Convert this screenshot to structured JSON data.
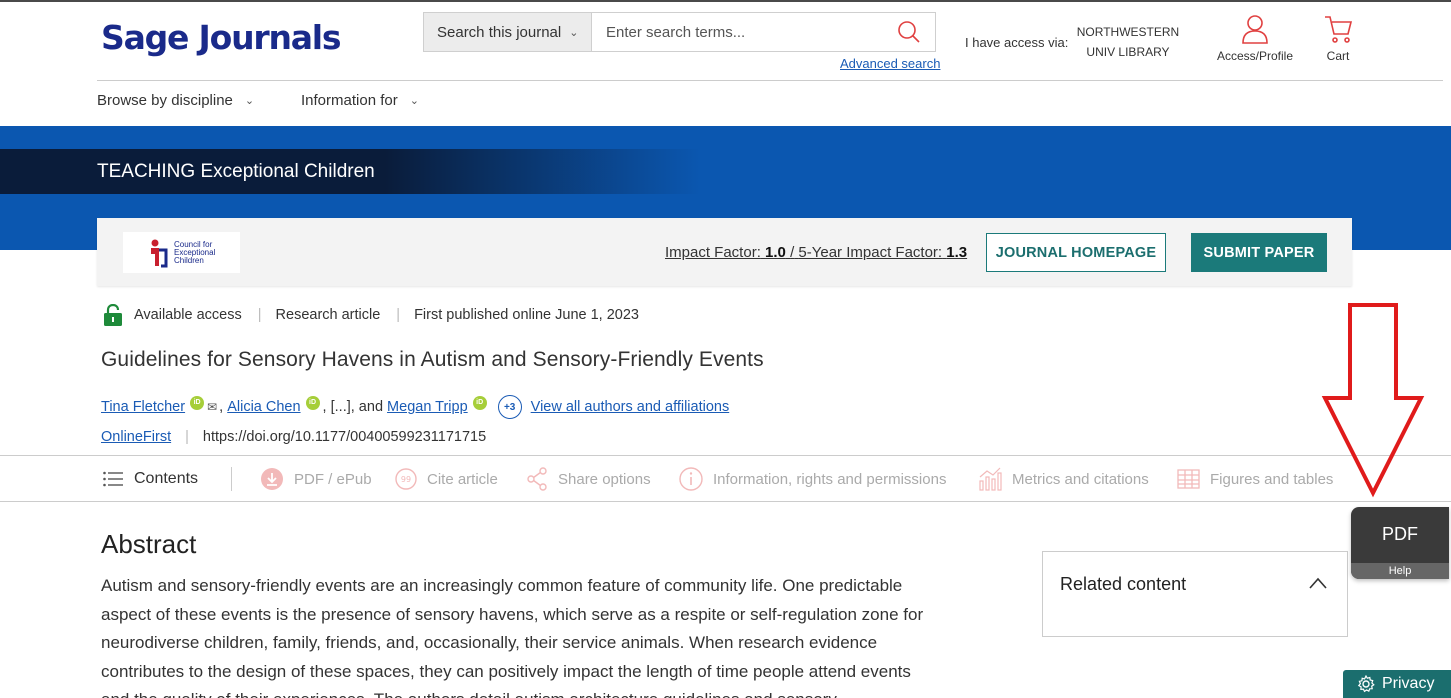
{
  "header": {
    "logo": "Sage Journals",
    "search_scope": "Search this journal",
    "search_placeholder": "Enter search terms...",
    "advanced_search": "Advanced search",
    "access_label": "I have access via:",
    "institution_line1": "NORTHWESTERN",
    "institution_line2": "UNIV LIBRARY",
    "profile_label": "Access/Profile",
    "cart_label": "Cart"
  },
  "nav": {
    "browse": "Browse by discipline",
    "info": "Information for"
  },
  "journal": {
    "title": "TEACHING Exceptional Children",
    "logo_line1": "Council for",
    "logo_line2": "Exceptional",
    "logo_line3": "Children",
    "impact_label": "Impact Factor:",
    "impact_value": "1.0",
    "impact_sep": "/",
    "five_year_label": "5-Year Impact Factor:",
    "five_year_value": "1.3",
    "homepage_button": "JOURNAL HOMEPAGE",
    "submit_button": "SUBMIT PAPER"
  },
  "article": {
    "access": "Available access",
    "type": "Research article",
    "published": "First published online June 1, 2023",
    "title": "Guidelines for Sensory Havens in Autism and Sensory-Friendly Events",
    "authors": [
      "Tina Fletcher",
      "Alicia Chen",
      "Megan Tripp"
    ],
    "ellipsis": "[...], and",
    "more_count": "+3",
    "view_all": "View all authors and affiliations",
    "status": "OnlineFirst",
    "doi": "https://doi.org/10.1177/00400599231171715",
    "orcid_label": "iD"
  },
  "toolbar": {
    "contents": "Contents",
    "pdf": "PDF / ePub",
    "cite": "Cite article",
    "share": "Share options",
    "info": "Information, rights and permissions",
    "metrics": "Metrics and citations",
    "figures": "Figures and tables"
  },
  "abstract": {
    "heading": "Abstract",
    "text": "Autism and sensory-friendly events are an increasingly common feature of community life. One predictable aspect of these events is the presence of sensory havens, which serve as a respite or self-regulation zone for neurodiverse children, family, friends, and, occasionally, their service animals. When research evidence contributes to the design of these spaces, they can positively impact the length of time people attend events and the quality of their experiences. The authors detail autism architecture guidelines and sensory"
  },
  "sidebar": {
    "related": "Related content"
  },
  "widgets": {
    "pdf": "PDF",
    "help": "Help",
    "privacy": "Privacy"
  },
  "colors": {
    "brand_blue": "#1a2a8a",
    "banner_blue": "#0b57b0",
    "teal": "#1b7a7a",
    "link": "#1a5bb5",
    "annotation_red": "#e01b1b"
  }
}
